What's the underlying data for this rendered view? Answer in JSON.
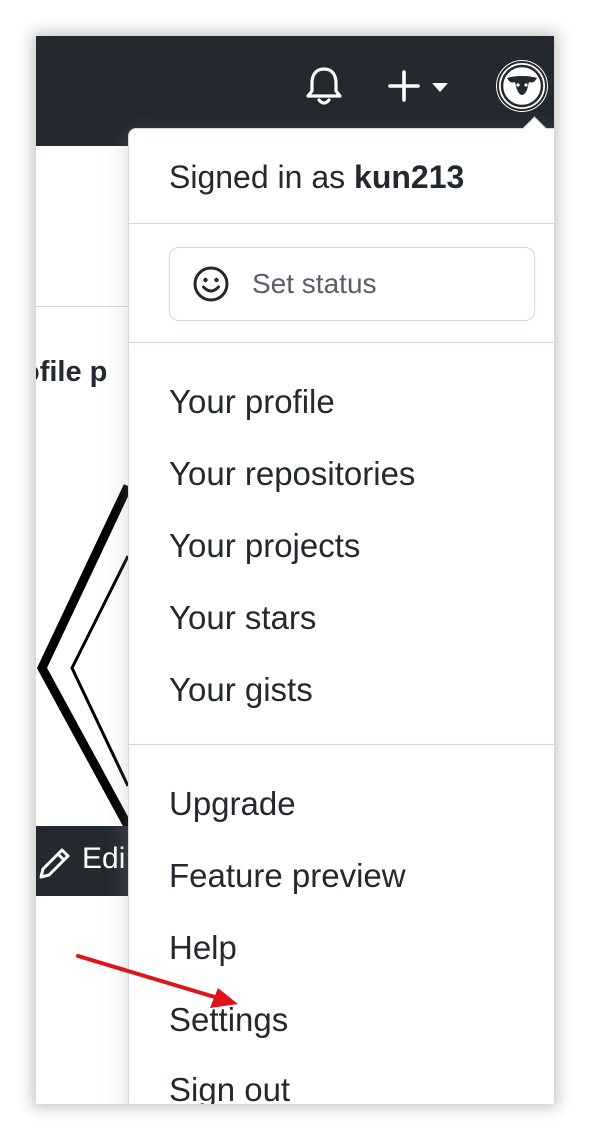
{
  "header": {
    "notifications_icon": "bell-icon",
    "create_icon": "plus-icon",
    "create_caret_icon": "caret-down-icon",
    "avatar_icon": "bull-avatar-icon",
    "background_color": "#24292f"
  },
  "background_page": {
    "heading_fragment": "ofile p",
    "edit_label": "Edi",
    "edit_icon": "pencil-icon"
  },
  "dropdown": {
    "signed_in_prefix": "Signed in as",
    "username": "kun213",
    "status_button_label": "Set status",
    "status_icon": "smiley-icon",
    "sections": [
      [
        "Your profile",
        "Your repositories",
        "Your projects",
        "Your stars",
        "Your gists"
      ],
      [
        "Upgrade",
        "Feature preview",
        "Help",
        "Settings",
        "Sign out"
      ]
    ]
  },
  "annotation": {
    "arrow_color": "#e0121b",
    "points_to": "Settings"
  }
}
